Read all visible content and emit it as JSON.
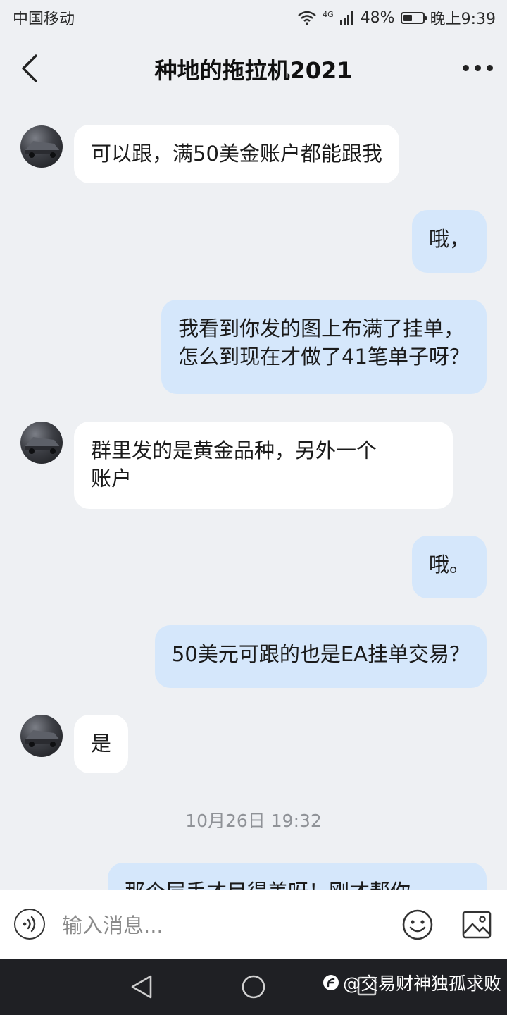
{
  "status_bar": {
    "carrier": "中国移动",
    "network": "4G",
    "battery": "48%",
    "battery_level": 0.48,
    "time": "晚上9:39"
  },
  "header": {
    "title": "种地的拖拉机2021"
  },
  "messages": [
    {
      "direction": "incoming",
      "text": "可以跟，满50美金账户都能跟我"
    },
    {
      "direction": "outgoing",
      "text": "哦，"
    },
    {
      "direction": "outgoing",
      "lines": [
        "我看到你发的图上布满了挂单，",
        "怎么到现在才做了41笔单子呀？"
      ]
    },
    {
      "direction": "incoming",
      "lines": [
        "群里发的是黄金品种，另外一个",
        "账户"
      ]
    },
    {
      "direction": "outgoing",
      "text": "哦。"
    },
    {
      "direction": "outgoing",
      "text": "50美元可跟的也是EA挂单交易？"
    },
    {
      "direction": "incoming",
      "text": "是"
    },
    {
      "direction": "timestamp",
      "text": "10月26日 19:32"
    },
    {
      "direction": "outgoing",
      "text": "那个层手才目得美呀！刚才帮你"
    }
  ],
  "input": {
    "placeholder": "输入消息..."
  },
  "watermark": {
    "text": "@交易财神独孤求败"
  },
  "colors": {
    "background": "#eef0f3",
    "incoming_bubble": "#ffffff",
    "outgoing_bubble": "#d5e7fb",
    "navbar": "#1f2024"
  }
}
